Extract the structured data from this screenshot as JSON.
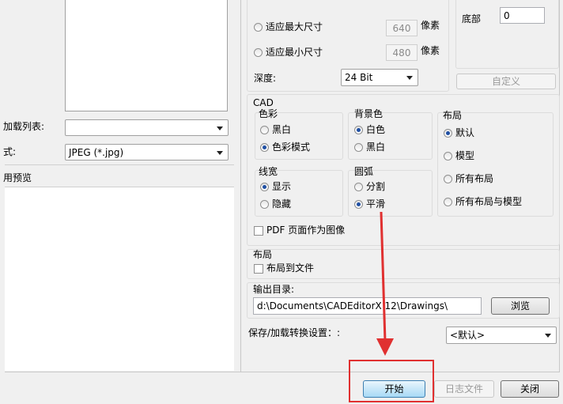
{
  "left": {
    "load_list_label": "加载列表:",
    "format_label": "式:",
    "format_value": "JPEG (*.jpg)",
    "preview_label": "用预览"
  },
  "image": {
    "fit_max_label": "适应最大尺寸",
    "fit_max_value": "640",
    "fit_max_unit": "像素",
    "fit_min_label": "适应最小尺寸",
    "fit_min_value": "480",
    "fit_min_unit": "像素",
    "depth_label": "深度:",
    "depth_value": "24 Bit"
  },
  "margins": {
    "bottom_label": "底部",
    "bottom_value": "0",
    "custom_button": "自定义"
  },
  "cad": {
    "title": "CAD",
    "color": {
      "title": "色彩",
      "options": [
        "黑白",
        "色彩模式"
      ],
      "selected": 1
    },
    "background": {
      "title": "背景色",
      "options": [
        "白色",
        "黑白"
      ],
      "selected": 0
    },
    "layout": {
      "title": "布局",
      "options": [
        "默认",
        "模型",
        "所有布局",
        "所有布局与模型"
      ],
      "selected": 0
    },
    "lineweight": {
      "title": "线宽",
      "options": [
        "显示",
        "隐藏"
      ],
      "selected": 0
    },
    "arc": {
      "title": "圆弧",
      "options": [
        "分割",
        "平滑"
      ],
      "selected": 1
    },
    "pdf_page_as_image": "PDF 页面作为图像"
  },
  "layout_section": {
    "title": "布局",
    "layout_to_file": "布局到文件"
  },
  "output": {
    "dir_label": "输出目录:",
    "dir_value": "d:\\Documents\\CADEditorX 12\\Drawings\\",
    "browse_button": "浏览"
  },
  "save_settings": {
    "label": "保存/加载转换设置：:",
    "value": "<默认>"
  },
  "footer": {
    "start_button": "开始",
    "log_button": "日志文件",
    "close_button": "关闭"
  },
  "colors": {
    "annotation_red": "#e03030"
  }
}
